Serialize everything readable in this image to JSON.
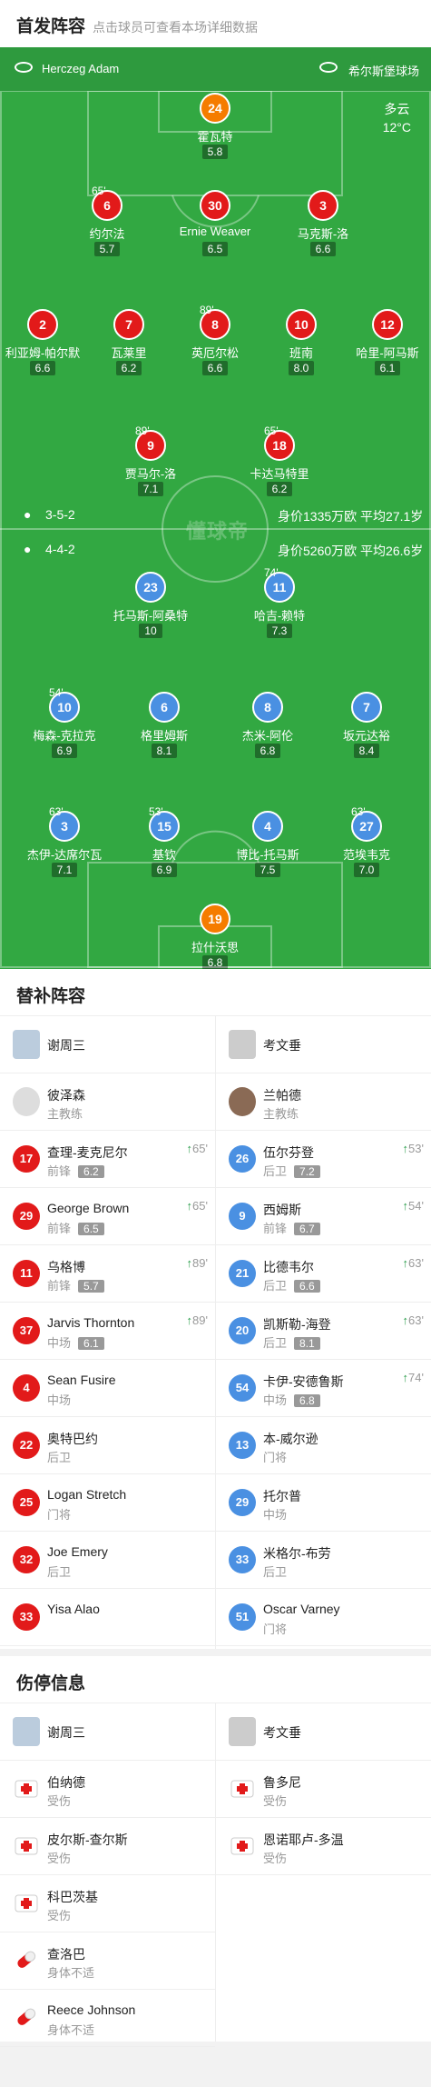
{
  "header": {
    "title": "首发阵容",
    "subtitle": "点击球员可查看本场详细数据"
  },
  "referee": "Herczeg Adam",
  "stadium": "希尔斯堡球场",
  "weather": {
    "desc": "多云",
    "temp": "12°C"
  },
  "home_stats": {
    "formation": "3-5-2",
    "info": "身价1335万欧 平均27.1岁"
  },
  "away_stats": {
    "formation": "4-4-2",
    "info": "身价5260万欧 平均26.6岁"
  },
  "watermark": "懂球帝",
  "home_players": [
    {
      "num": "24",
      "name": "霍瓦特",
      "rating": "5.8",
      "ev": ""
    },
    {
      "num": "6",
      "name": "约尔法",
      "rating": "5.7",
      "ev": "65'"
    },
    {
      "num": "30",
      "name": "Ernie Weaver",
      "rating": "6.5",
      "ev": ""
    },
    {
      "num": "3",
      "name": "马克斯-洛",
      "rating": "6.6",
      "ev": ""
    },
    {
      "num": "2",
      "name": "利亚姆-帕尔默",
      "rating": "6.6",
      "ev": ""
    },
    {
      "num": "7",
      "name": "瓦莱里",
      "rating": "6.2",
      "ev": ""
    },
    {
      "num": "8",
      "name": "英厄尔松",
      "rating": "6.6",
      "ev": "89'"
    },
    {
      "num": "10",
      "name": "班南",
      "rating": "8.0",
      "ev": ""
    },
    {
      "num": "12",
      "name": "哈里-阿马斯",
      "rating": "6.1",
      "ev": ""
    },
    {
      "num": "9",
      "name": "贾马尔-洛",
      "rating": "7.1",
      "ev": "89'"
    },
    {
      "num": "18",
      "name": "卡达马特里",
      "rating": "6.2",
      "ev": "65'"
    }
  ],
  "away_players": [
    {
      "num": "23",
      "name": "托马斯-阿桑特",
      "rating": "10",
      "ev": ""
    },
    {
      "num": "11",
      "name": "哈吉-赖特",
      "rating": "7.3",
      "ev": "74'"
    },
    {
      "num": "10",
      "name": "梅森-克拉克",
      "rating": "6.9",
      "ev": "54'"
    },
    {
      "num": "6",
      "name": "格里姆斯",
      "rating": "8.1",
      "ev": ""
    },
    {
      "num": "8",
      "name": "杰米-阿伦",
      "rating": "6.8",
      "ev": ""
    },
    {
      "num": "7",
      "name": "坂元达裕",
      "rating": "8.4",
      "ev": ""
    },
    {
      "num": "3",
      "name": "杰伊-达席尔瓦",
      "rating": "7.1",
      "ev": "63'"
    },
    {
      "num": "15",
      "name": "基钦",
      "rating": "6.9",
      "ev": "53'"
    },
    {
      "num": "4",
      "name": "博比-托马斯",
      "rating": "7.5",
      "ev": ""
    },
    {
      "num": "27",
      "name": "范埃韦克",
      "rating": "7.0",
      "ev": "63'"
    },
    {
      "num": "19",
      "name": "拉什沃思",
      "rating": "6.8",
      "ev": ""
    }
  ],
  "subs": {
    "title": "替补阵容",
    "home_team": "谢周三",
    "away_team": "考文垂",
    "home_coach": {
      "name": "彼泽森",
      "role": "主教练"
    },
    "away_coach": {
      "name": "兰帕德",
      "role": "主教练"
    },
    "home": [
      {
        "num": "17",
        "name": "查理-麦克尼尔",
        "pos": "前锋",
        "rating": "6.2",
        "min": "65'"
      },
      {
        "num": "29",
        "name": "George Brown",
        "pos": "前锋",
        "rating": "6.5",
        "min": "65'"
      },
      {
        "num": "11",
        "name": "乌格博",
        "pos": "前锋",
        "rating": "5.7",
        "min": "89'"
      },
      {
        "num": "37",
        "name": "Jarvis Thornton",
        "pos": "中场",
        "rating": "6.1",
        "min": "89'"
      },
      {
        "num": "4",
        "name": "Sean Fusire",
        "pos": "中场",
        "rating": "",
        "min": ""
      },
      {
        "num": "22",
        "name": "奥特巴约",
        "pos": "后卫",
        "rating": "",
        "min": ""
      },
      {
        "num": "25",
        "name": "Logan Stretch",
        "pos": "门将",
        "rating": "",
        "min": ""
      },
      {
        "num": "32",
        "name": "Joe Emery",
        "pos": "后卫",
        "rating": "",
        "min": ""
      },
      {
        "num": "33",
        "name": "Yisa Alao",
        "pos": "",
        "rating": "",
        "min": ""
      }
    ],
    "away": [
      {
        "num": "26",
        "name": "伍尔芬登",
        "pos": "后卫",
        "rating": "7.2",
        "min": "53'"
      },
      {
        "num": "9",
        "name": "西姆斯",
        "pos": "前锋",
        "rating": "6.7",
        "min": "54'"
      },
      {
        "num": "21",
        "name": "比德韦尔",
        "pos": "后卫",
        "rating": "6.6",
        "min": "63'"
      },
      {
        "num": "20",
        "name": "凯斯勒-海登",
        "pos": "后卫",
        "rating": "8.1",
        "min": "63'"
      },
      {
        "num": "54",
        "name": "卡伊-安德鲁斯",
        "pos": "中场",
        "rating": "6.8",
        "min": "74'"
      },
      {
        "num": "13",
        "name": "本-威尔逊",
        "pos": "门将",
        "rating": "",
        "min": ""
      },
      {
        "num": "29",
        "name": "托尔普",
        "pos": "中场",
        "rating": "",
        "min": ""
      },
      {
        "num": "33",
        "name": "米格尔-布劳",
        "pos": "后卫",
        "rating": "",
        "min": ""
      },
      {
        "num": "51",
        "name": "Oscar Varney",
        "pos": "门将",
        "rating": "",
        "min": ""
      }
    ]
  },
  "injuries": {
    "title": "伤停信息",
    "home_team": "谢周三",
    "away_team": "考文垂",
    "home": [
      {
        "name": "伯纳德",
        "status": "受伤",
        "type": "injury"
      },
      {
        "name": "皮尔斯-查尔斯",
        "status": "受伤",
        "type": "injury"
      },
      {
        "name": "科巴茨基",
        "status": "受伤",
        "type": "injury"
      },
      {
        "name": "查洛巴",
        "status": "身体不适",
        "type": "ill"
      },
      {
        "name": "Reece Johnson",
        "status": "身体不适",
        "type": "ill"
      }
    ],
    "away": [
      {
        "name": "鲁多尼",
        "status": "受伤",
        "type": "injury"
      },
      {
        "name": "恩诺耶卢-多温",
        "status": "受伤",
        "type": "injury"
      }
    ]
  },
  "colors": {
    "home": "#e21a1a",
    "away": "#4a90e2",
    "keeper_home": "#f57c00",
    "pitch": "#32a842"
  }
}
